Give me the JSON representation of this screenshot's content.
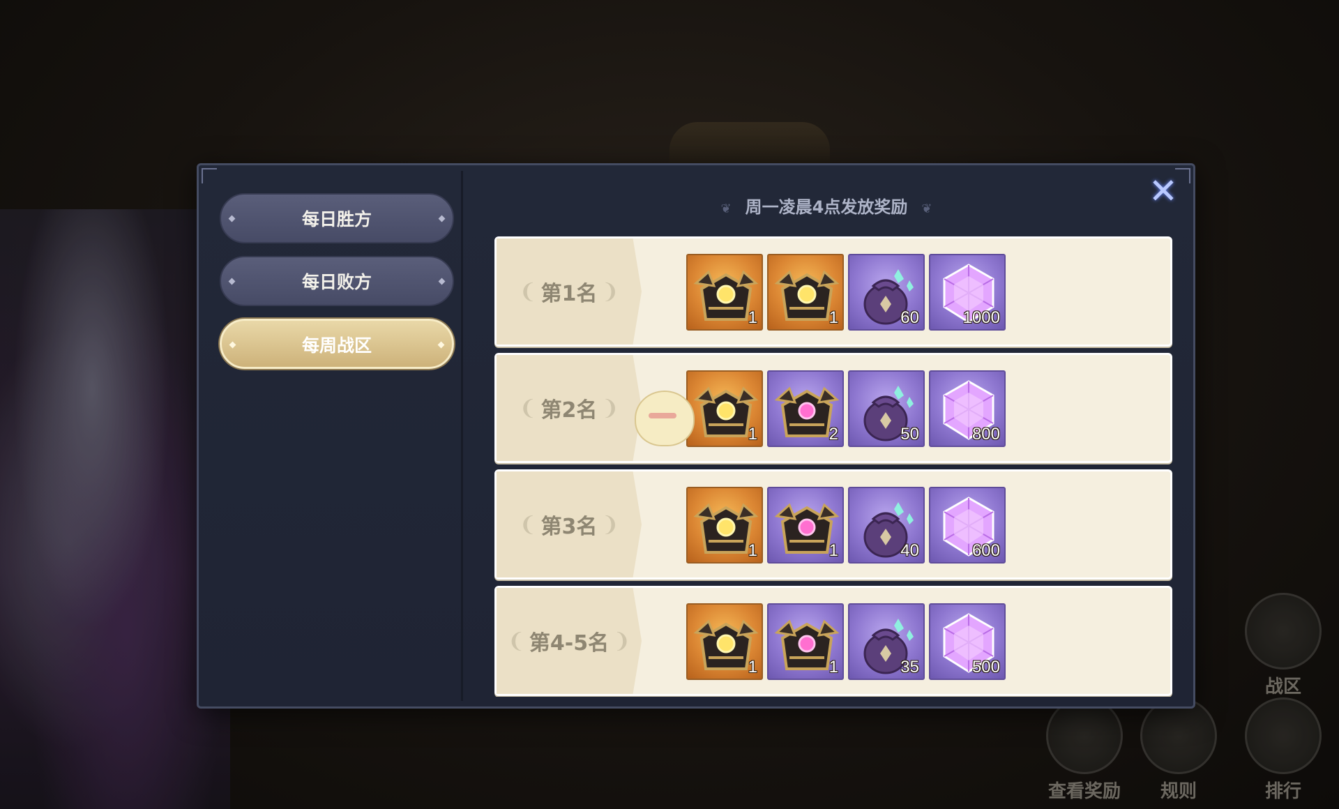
{
  "header": {
    "notice": "周一凌晨4点发放奖励"
  },
  "tabs": [
    {
      "label": "每日胜方",
      "active": false
    },
    {
      "label": "每日败方",
      "active": false
    },
    {
      "label": "每周战区",
      "active": true
    }
  ],
  "close": {
    "label": "✕"
  },
  "rewards": [
    {
      "rank": "第1名",
      "items": [
        {
          "icon": "gold-chest-icon",
          "count": "1",
          "frame": "orange"
        },
        {
          "icon": "gold-chest-icon",
          "count": "1",
          "frame": "orange"
        },
        {
          "icon": "crystal-bag-icon",
          "count": "60",
          "frame": "purple"
        },
        {
          "icon": "purple-gem-icon",
          "count": "1000",
          "frame": "purple"
        }
      ]
    },
    {
      "rank": "第2名",
      "items": [
        {
          "icon": "gold-chest-icon",
          "count": "1",
          "frame": "orange"
        },
        {
          "icon": "pink-chest-icon",
          "count": "2",
          "frame": "purple"
        },
        {
          "icon": "crystal-bag-icon",
          "count": "50",
          "frame": "purple"
        },
        {
          "icon": "purple-gem-icon",
          "count": "800",
          "frame": "purple"
        }
      ]
    },
    {
      "rank": "第3名",
      "items": [
        {
          "icon": "gold-chest-icon",
          "count": "1",
          "frame": "orange"
        },
        {
          "icon": "pink-chest-icon",
          "count": "1",
          "frame": "purple"
        },
        {
          "icon": "crystal-bag-icon",
          "count": "40",
          "frame": "purple"
        },
        {
          "icon": "purple-gem-icon",
          "count": "600",
          "frame": "purple"
        }
      ]
    },
    {
      "rank": "第4-5名",
      "items": [
        {
          "icon": "gold-chest-icon",
          "count": "1",
          "frame": "orange"
        },
        {
          "icon": "pink-chest-icon",
          "count": "1",
          "frame": "purple"
        },
        {
          "icon": "crystal-bag-icon",
          "count": "35",
          "frame": "purple"
        },
        {
          "icon": "purple-gem-icon",
          "count": "500",
          "frame": "purple"
        }
      ]
    }
  ],
  "bottom_nav": {
    "zone": "战区",
    "view_rewards": "查看奖励",
    "rules": "规则",
    "ranking": "排行"
  },
  "colors": {
    "tab_active": "#d9c38e",
    "tab_normal": "#515572",
    "panel": "#222838",
    "row_bg": "#f5efdf",
    "item_orange": "#db8633",
    "item_purple": "#8e77d0"
  }
}
